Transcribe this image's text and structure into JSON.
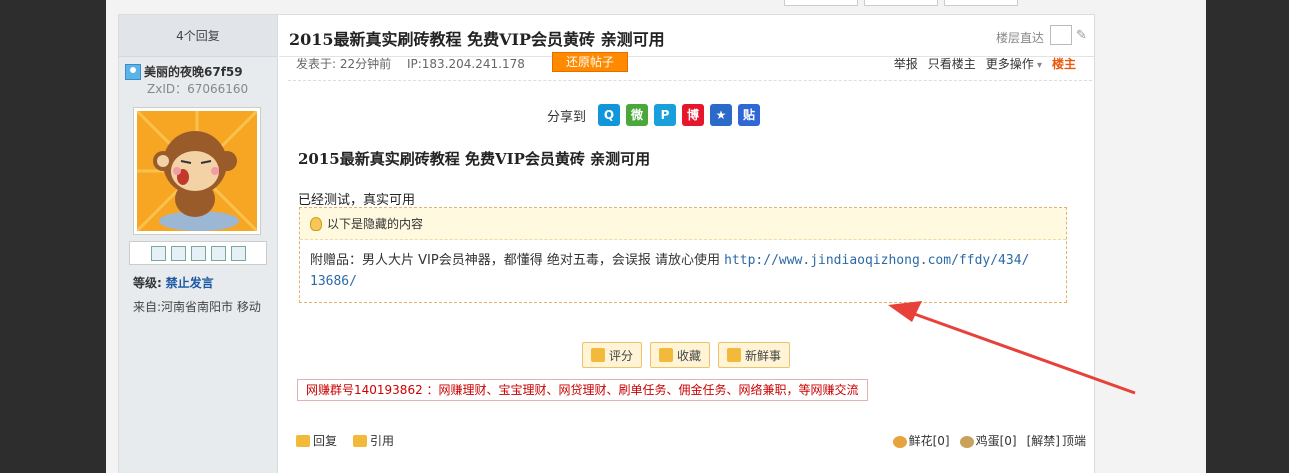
{
  "left": {
    "replies": "4个回复",
    "username": "美丽的夜晚67f59",
    "zxid": "ZxID：67066160",
    "level_label": "等级:",
    "level_value": "禁止发言",
    "from": "来自:河南省南阳市 移动"
  },
  "header": {
    "title": "2015最新真实刷砖教程  免费VIP会员黄砖 亲测可用",
    "jump_label": "楼层直达"
  },
  "meta": {
    "posted": "发表于: 22分钟前",
    "ip": "IP:183.204.241.178",
    "restore_button": "还原帖子",
    "report": "举报",
    "only_host": "只看楼主",
    "more": "更多操作",
    "host": "楼主"
  },
  "share": {
    "label": "分享到",
    "icons": [
      {
        "name": "qq-icon",
        "color": "#1296db",
        "glyph": "Q"
      },
      {
        "name": "wechat-icon",
        "color": "#4aa83a",
        "glyph": "微"
      },
      {
        "name": "p-icon",
        "color": "#19a0dc",
        "glyph": "P"
      },
      {
        "name": "weibo-icon",
        "color": "#e6162d",
        "glyph": "博"
      },
      {
        "name": "star-icon",
        "color": "#2a6ac8",
        "glyph": "★"
      },
      {
        "name": "tieba-icon",
        "color": "#2f68d6",
        "glyph": "贴"
      }
    ]
  },
  "content": {
    "title": "2015最新真实刷砖教程  免费VIP会员黄砖 亲测可用",
    "line1": "已经测试，真实可用",
    "hidden_heading": "以下是隐藏的内容",
    "hidden_text": "附赠品：男人大片 VIP会员神器，都懂得 绝对五毒，会误报 请放心使用 ",
    "hidden_link_1": "http://www.jindiaoqizhong.com/ffdy/434/",
    "hidden_link_2": "13686/"
  },
  "buttons": {
    "rate": "评分",
    "collect": "收藏",
    "news": "新鲜事"
  },
  "ad": "网赚群号140193862 ：网赚理财、宝宝理财、网贷理财、刷单任务、佣金任务、网络兼职，等网赚交流",
  "footer": {
    "reply": "回复",
    "quote": "引用",
    "flowers": "鲜花[0]",
    "eggs": "鸡蛋[0]",
    "unlock": "[解禁]",
    "top": "顶端"
  },
  "colors": {
    "arrow": "#e8413a",
    "restore": "#ff8a00",
    "link": "#2b6aa6"
  }
}
